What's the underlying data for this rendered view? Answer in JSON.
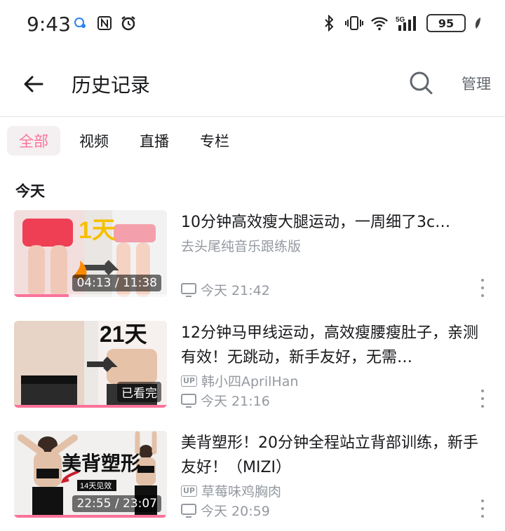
{
  "status_bar": {
    "time": "9:43",
    "network": "5G",
    "battery": "95"
  },
  "header": {
    "title": "历史记录",
    "manage_label": "管理"
  },
  "tabs": [
    {
      "label": "全部",
      "active": true
    },
    {
      "label": "视频",
      "active": false
    },
    {
      "label": "直播",
      "active": false
    },
    {
      "label": "专栏",
      "active": false
    }
  ],
  "section_label": "今天",
  "items": [
    {
      "title": "10分钟高效瘦大腿运动，一周细了3c…",
      "author": "去头尾纯音乐跟练版",
      "has_up_badge": false,
      "time": "今天 21:42",
      "badge": "04:13 / 11:38",
      "progress": 0.36,
      "thumb_text": "1天"
    },
    {
      "title": "12分钟马甲线运动，高效瘦腰瘦肚子，亲测有效！无跳动，新手友好，无需…",
      "author": "韩小四AprilHan",
      "has_up_badge": true,
      "time": "今天 21:16",
      "badge": "已看完",
      "progress": 1.0,
      "thumb_text": "21天"
    },
    {
      "title": "美背塑形！20分钟全程站立背部训练，新手友好！（MIZI）",
      "author": "草莓味鸡胸肉",
      "has_up_badge": true,
      "time": "今天 20:59",
      "badge": "22:55 / 23:07",
      "progress": 0.99,
      "thumb_text": "美背塑形",
      "thumb_subtext": "14天见效"
    }
  ]
}
